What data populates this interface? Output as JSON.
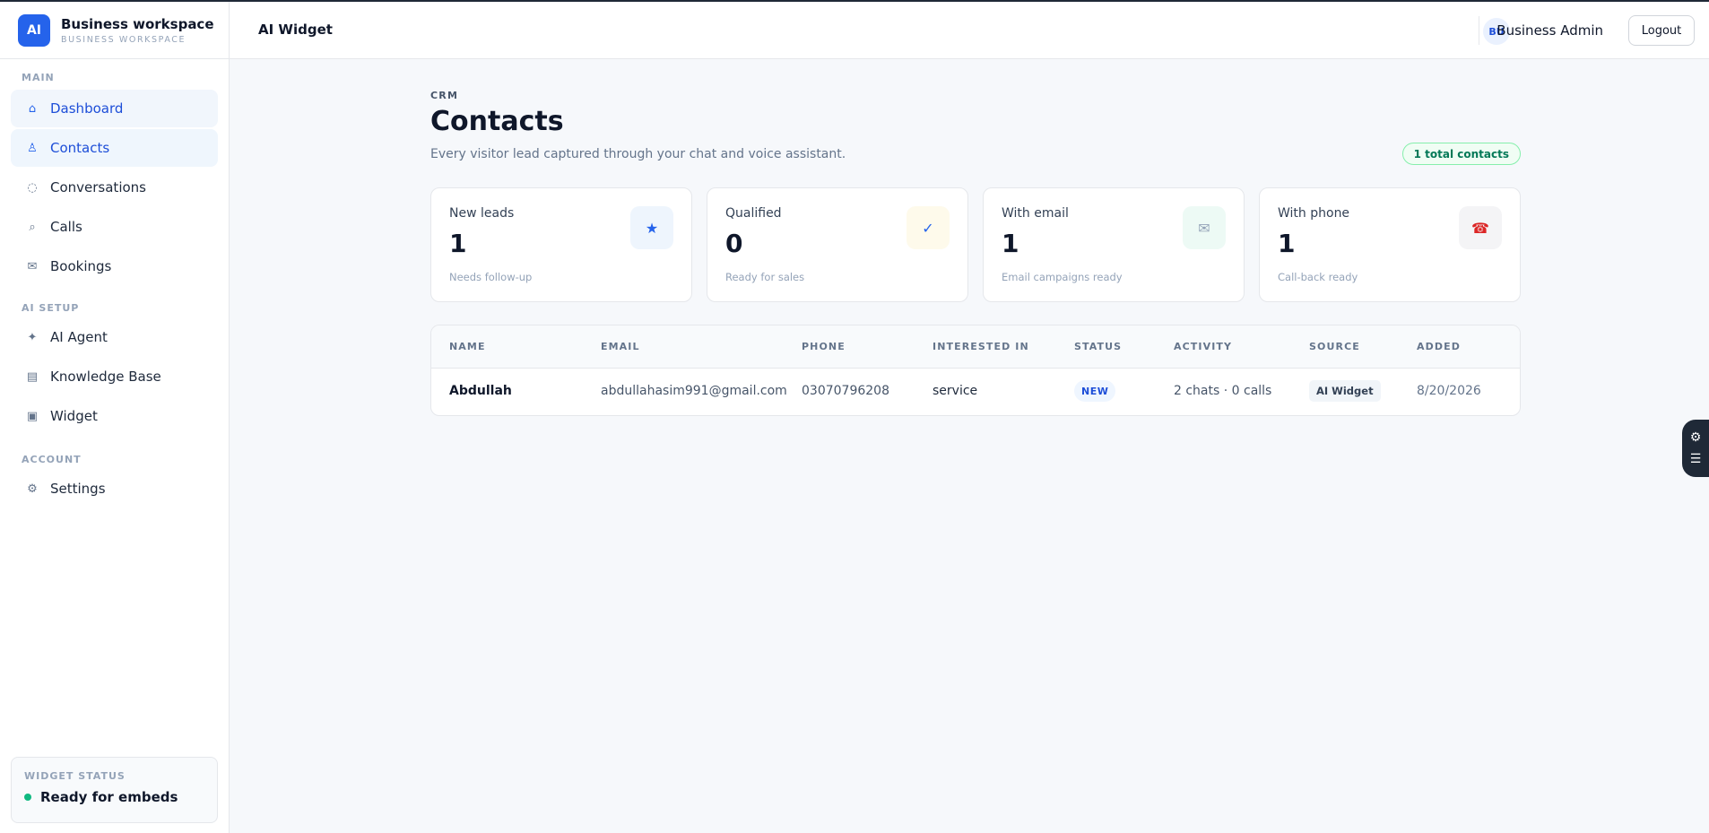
{
  "brand": {
    "logo": "AI",
    "name": "Business workspace",
    "sub": "BUSINESS WORKSPACE"
  },
  "sidebar": {
    "sections": [
      {
        "label": "MAIN"
      },
      {
        "label": "AI SETUP"
      },
      {
        "label": "ACCOUNT"
      }
    ],
    "items": [
      {
        "label": "Dashboard",
        "icon": "home-icon",
        "glyph": "⌂"
      },
      {
        "label": "Contacts",
        "icon": "person-icon",
        "glyph": "♙"
      },
      {
        "label": "Conversations",
        "icon": "chat-circle-icon",
        "glyph": "◌"
      },
      {
        "label": "Calls",
        "icon": "phone-icon",
        "glyph": "⌕"
      },
      {
        "label": "Bookings",
        "icon": "calendar-icon",
        "glyph": "✉"
      },
      {
        "label": "AI Agent",
        "icon": "sparkle-icon",
        "glyph": "✦"
      },
      {
        "label": "Knowledge Base",
        "icon": "book-icon",
        "glyph": "▤"
      },
      {
        "label": "Widget",
        "icon": "widget-icon",
        "glyph": "▣"
      },
      {
        "label": "Settings",
        "icon": "gear-icon",
        "glyph": "⚙"
      }
    ],
    "widget_status": {
      "label": "WIDGET STATUS",
      "value": "Ready for embeds"
    }
  },
  "topbar": {
    "title": "AI Widget",
    "avatar": "BU",
    "user": "Business Admin",
    "logout": "Logout"
  },
  "page": {
    "eyebrow": "CRM",
    "title": "Contacts",
    "subtitle": "Every visitor lead captured through your chat and voice assistant.",
    "total_badge": "1 total contacts"
  },
  "stats": [
    {
      "label": "New leads",
      "value": "1",
      "note": "Needs follow-up",
      "icon": "star-icon",
      "glyph": "★",
      "icon_color": "#2563eb",
      "icon_bg": "#eef5fd"
    },
    {
      "label": "Qualified",
      "value": "0",
      "note": "Ready for sales",
      "icon": "check-icon",
      "glyph": "✓",
      "icon_color": "#2563eb",
      "icon_bg": "#fefaeb"
    },
    {
      "label": "With email",
      "value": "1",
      "note": "Email campaigns ready",
      "icon": "mail-icon",
      "glyph": "✉",
      "icon_color": "#94a3b8",
      "icon_bg": "#edfaf5"
    },
    {
      "label": "With phone",
      "value": "1",
      "note": "Call-back ready",
      "icon": "telephone-icon",
      "glyph": "☎",
      "icon_color": "#dc2626",
      "icon_bg": "#f4f4f6"
    }
  ],
  "table": {
    "columns": [
      "NAME",
      "EMAIL",
      "PHONE",
      "INTERESTED IN",
      "STATUS",
      "ACTIVITY",
      "SOURCE",
      "ADDED"
    ],
    "rows": [
      {
        "name": "Abdullah",
        "email": "abdullahasim991@gmail.com",
        "phone": "03070796208",
        "interested_in": "service",
        "status": "NEW",
        "activity": "2 chats · 0 calls",
        "source": "AI Widget",
        "added": "8/20/2026"
      }
    ]
  },
  "float_tool": {
    "icons": [
      "settings-icon",
      "list-icon"
    ]
  }
}
